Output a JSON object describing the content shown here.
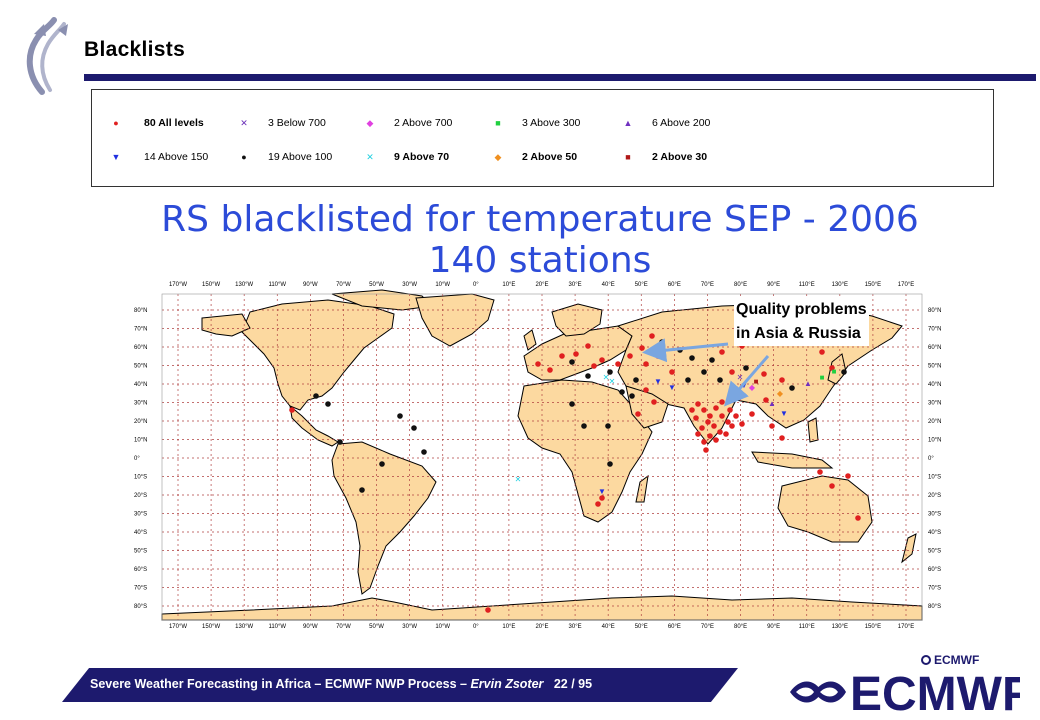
{
  "slide": {
    "title": "Blacklists"
  },
  "legend": [
    {
      "symbol": "●",
      "color": "#e02020",
      "label": "80 All levels",
      "bold": true
    },
    {
      "symbol": "✕",
      "color": "#6a2fb8",
      "label": "3 Below 700",
      "bold": false
    },
    {
      "symbol": "◆",
      "color": "#e040e0",
      "label": "2 Above 700",
      "bold": false
    },
    {
      "symbol": "■",
      "color": "#20d040",
      "label": "3 Above 300",
      "bold": false
    },
    {
      "symbol": "▲",
      "color": "#7030c0",
      "label": "6 Above 200",
      "bold": false
    },
    {
      "symbol": "▼",
      "color": "#2030e0",
      "label": "14 Above 150",
      "bold": false
    },
    {
      "symbol": "●",
      "color": "#111111",
      "label": "19 Above 100",
      "bold": false
    },
    {
      "symbol": "✕",
      "color": "#20d0e0",
      "label": "9 Above 70",
      "bold": true
    },
    {
      "symbol": "◆",
      "color": "#f09020",
      "label": "2 Above 50",
      "bold": true
    },
    {
      "symbol": "■",
      "color": "#b01818",
      "label": "2 Above 30",
      "bold": true
    }
  ],
  "map": {
    "title_line1": "RS blacklisted for temperature SEP - 2006",
    "title_line2": "140 stations",
    "lon_labels": [
      "170°W",
      "150°W",
      "130°W",
      "110°W",
      "90°W",
      "70°W",
      "50°W",
      "30°W",
      "10°W",
      "0°",
      "10°E",
      "20°E",
      "30°E",
      "40°E",
      "50°E",
      "60°E",
      "70°E",
      "80°E",
      "90°E",
      "110°E",
      "130°E",
      "150°E",
      "170°E"
    ],
    "lat_labels_left": [
      "80°N",
      "70°N",
      "60°N",
      "50°N",
      "40°N",
      "30°N",
      "20°N",
      "10°N",
      "0°",
      "10°S",
      "20°S",
      "30°S",
      "40°S",
      "50°S",
      "60°S",
      "70°S",
      "80°S"
    ],
    "lat_labels_right": [
      "80°N",
      "70°N",
      "60°N",
      "50°N",
      "40°N",
      "30°N",
      "20°N",
      "10°N",
      "0°",
      "10°S",
      "20°S",
      "30°S",
      "40°S",
      "50°S",
      "60°S",
      "70°S",
      "80°S"
    ],
    "annotation_line1": "Quality problems",
    "annotation_line2": "in Asia & Russia",
    "colors": {
      "land": "#fcd9a0",
      "coast": "#000000",
      "grid": "#b04040",
      "arrow": "#7aa6e0"
    }
  },
  "footer": {
    "text_main": "Severe Weather Forecasting in Africa – ECMWF NWP Process – ",
    "author": "Ervin Zsoter",
    "page": "22 / 95"
  },
  "logo": {
    "text": "ECMWF",
    "small_text": "ECMWF",
    "color": "#1d1a6e"
  }
}
